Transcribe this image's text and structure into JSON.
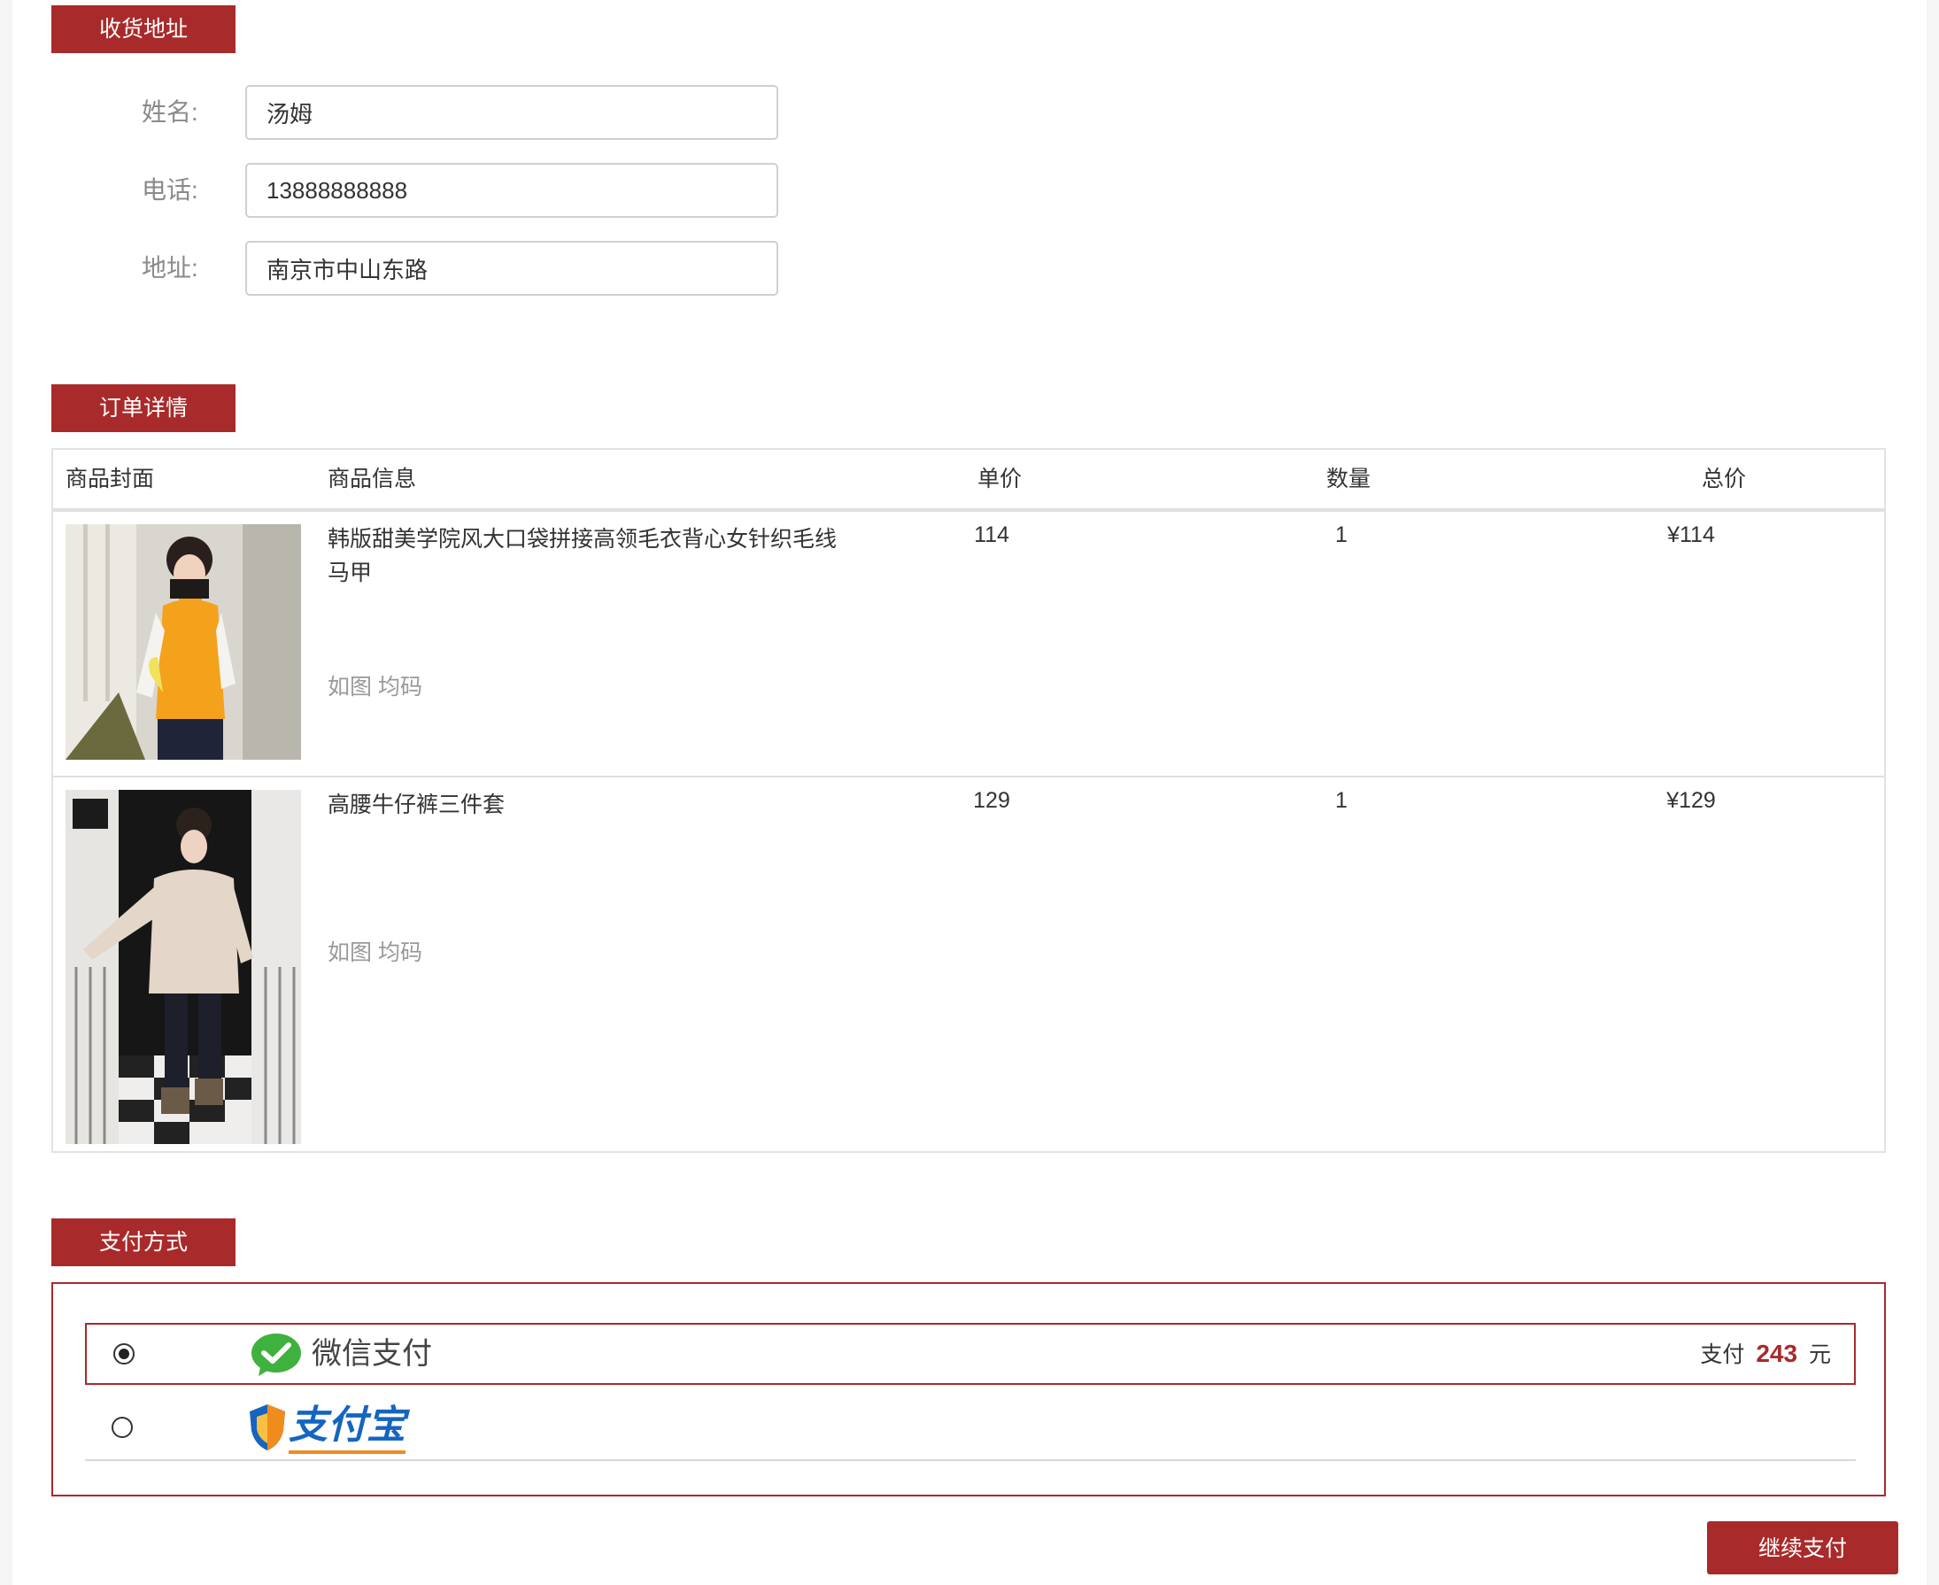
{
  "address_section": {
    "title": "收货地址",
    "fields": [
      {
        "label": "姓名:",
        "value": "汤姆"
      },
      {
        "label": "电话:",
        "value": "13888888888"
      },
      {
        "label": "地址:",
        "value": "南京市中山东路"
      }
    ]
  },
  "order_section": {
    "title": "订单详情",
    "columns": [
      "商品封面",
      "商品信息",
      "单价",
      "数量",
      "总价"
    ],
    "items": [
      {
        "name": "韩版甜美学院风大口袋拼接高领毛衣背心女针织毛线马甲",
        "spec": "如图 均码",
        "price": "114",
        "qty": "1",
        "total": "¥114"
      },
      {
        "name": "高腰牛仔裤三件套",
        "spec": "如图 均码",
        "price": "129",
        "qty": "1",
        "total": "¥129"
      }
    ]
  },
  "payment_section": {
    "title": "支付方式",
    "options": [
      {
        "label": "微信支付",
        "icon": "wechat-pay-icon",
        "selected": true
      },
      {
        "label": "支付宝",
        "icon": "alipay-icon",
        "selected": false
      }
    ],
    "amount_prefix": "支付",
    "amount": "243",
    "amount_suffix": "元"
  },
  "continue_button": "继续支付",
  "colors": {
    "accent": "#a92a2a",
    "wechat_green": "#3fb13e",
    "alipay_orange": "#f08c1e",
    "alipay_blue": "#1565c0"
  }
}
